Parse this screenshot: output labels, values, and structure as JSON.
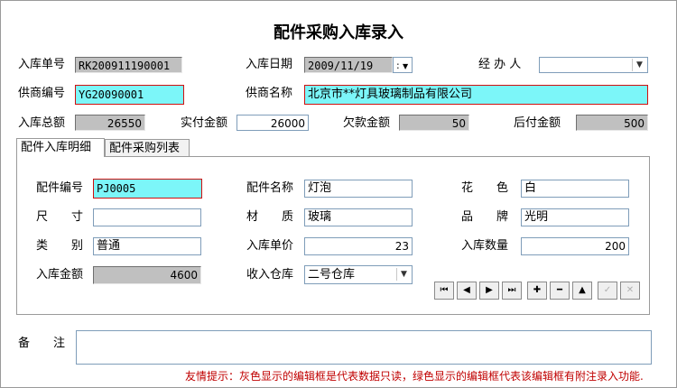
{
  "title": "配件采购入库录入",
  "header": {
    "receipt_no_label": "入库单号",
    "receipt_no": "RK200911190001",
    "date_label": "入库日期",
    "date": "2009/11/19",
    "handler_label": "经 办 人",
    "handler": "",
    "supplier_code_label": "供商编号",
    "supplier_code": "YG20090001",
    "supplier_name_label": "供商名称",
    "supplier_name": "北京市**灯具玻璃制品有限公司",
    "total_label": "入库总额",
    "total": "26550",
    "paid_label": "实付金额",
    "paid": "26000",
    "owed_label": "欠款金额",
    "owed": "50",
    "later_label": "后付金额",
    "later": "500"
  },
  "tabs": [
    {
      "label": "配件入库明细"
    },
    {
      "label": "配件采购列表"
    }
  ],
  "detail": {
    "part_no_label": "配件编号",
    "part_no": "PJ0005",
    "part_name_label": "配件名称",
    "part_name": "灯泡",
    "color_label": "花　　色",
    "color": "白",
    "size_label": "尺　　寸",
    "size": "",
    "material_label": "材　　质",
    "material": "玻璃",
    "brand_label": "品　　牌",
    "brand": "光明",
    "category_label": "类　　别",
    "category": "普通",
    "unit_price_label": "入库单价",
    "unit_price": "23",
    "quantity_label": "入库数量",
    "quantity": "200",
    "amount_label": "入库金额",
    "amount": "4600",
    "warehouse_label": "收入仓库",
    "warehouse": "二号仓库"
  },
  "nav": {
    "first": "⏮",
    "prev": "◀",
    "next": "▶",
    "last": "⏭",
    "add": "✚",
    "delete": "━",
    "up": "▲",
    "confirm": "✓",
    "cancel": "✕"
  },
  "memo_label": "备　　注",
  "memo": "",
  "tip": "友情提示：灰色显示的编辑框是代表数据只读，绿色显示的编辑框代表该编辑框有附注录入功能."
}
